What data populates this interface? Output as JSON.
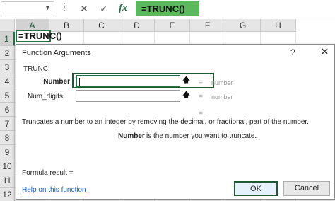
{
  "formula_bar": {
    "name_box": "",
    "cancel_glyph": "✕",
    "enter_glyph": "✓",
    "fx_label": "fx",
    "content": "=TRUNC()"
  },
  "grid": {
    "columns": [
      "A",
      "B",
      "C",
      "D",
      "E",
      "F",
      "G",
      "H"
    ],
    "rows": [
      "1",
      "2",
      "3",
      "4",
      "5",
      "6",
      "7",
      "8",
      "9",
      "10",
      "11",
      "12"
    ],
    "active_cell_value": "=TRUNC()"
  },
  "dialog": {
    "title": "Function Arguments",
    "help_glyph": "?",
    "close_glyph": "✕",
    "function_name": "TRUNC",
    "args": [
      {
        "label": "Number",
        "value": "",
        "equals": "=",
        "result": "number",
        "ref_icon": "🡅"
      },
      {
        "label": "Num_digits",
        "value": "",
        "equals": "=",
        "result": "number",
        "ref_icon": "🡅"
      }
    ],
    "result_equals": "=",
    "description": "Truncates a number to an integer by removing the decimal, or fractional, part of the number.",
    "arg_desc_name": "Number",
    "arg_desc_text": "is the number you want to truncate.",
    "formula_result": "Formula result =",
    "help_link": "Help on this function",
    "ok_label": "OK",
    "cancel_label": "Cancel"
  },
  "colors": {
    "accent": "#217346",
    "formula_highlight": "#5cb85c"
  }
}
